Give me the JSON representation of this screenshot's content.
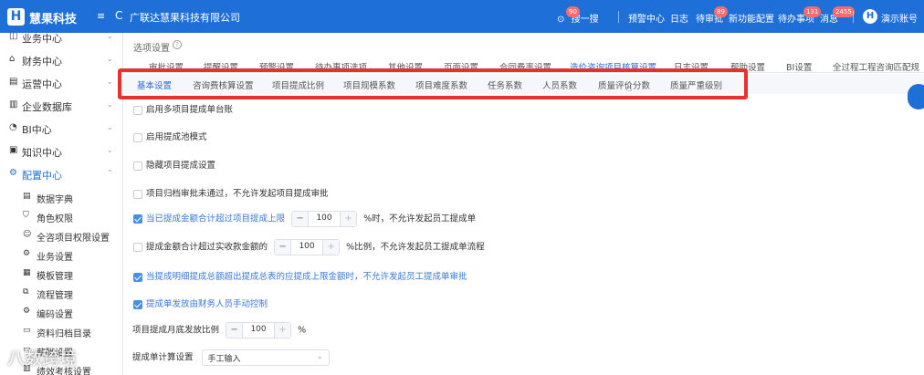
{
  "header": {
    "logo_letter": "H",
    "brand": "慧果科技",
    "menu_icon": "≡",
    "refresh_icon": "C",
    "company": "广联达慧果科技有限公司",
    "items": [
      {
        "label": "搜一搜",
        "badge": "90"
      },
      {
        "label": "预警中心",
        "badge": ""
      },
      {
        "label": "日志",
        "badge": ""
      },
      {
        "label": "待审批",
        "badge": "89"
      },
      {
        "label": "新功能配置",
        "badge": ""
      },
      {
        "label": "待办事项",
        "badge": "131"
      },
      {
        "label": "消息",
        "badge": "2455"
      },
      {
        "label": "演示账号",
        "badge": ""
      }
    ],
    "avatar_letter": "H"
  },
  "sidebar": {
    "items": [
      {
        "icon": "briefcase-icon",
        "label": "业务中心"
      },
      {
        "icon": "home-icon",
        "label": "财务中心"
      },
      {
        "icon": "building-icon",
        "label": "运营中心"
      },
      {
        "icon": "bar-chart-icon",
        "label": "企业数据库"
      },
      {
        "icon": "pie-icon",
        "label": "BI中心"
      },
      {
        "icon": "book-icon",
        "label": "知识中心"
      },
      {
        "icon": "gear-icon",
        "label": "配置中心"
      }
    ],
    "subitems": [
      {
        "label": "数据字典"
      },
      {
        "label": "角色权限"
      },
      {
        "label": "全咨项目权限设置"
      },
      {
        "label": "业务设置"
      },
      {
        "label": "模板管理"
      },
      {
        "label": "流程管理"
      },
      {
        "label": "编码设置"
      },
      {
        "label": "资料归档目录"
      },
      {
        "label": "薪酬设置"
      },
      {
        "label": "绩效考核设置"
      }
    ]
  },
  "main": {
    "breadcrumb": "选项设置",
    "help": "?",
    "tabs1": [
      {
        "label": "审批设置"
      },
      {
        "label": "提醒设置"
      },
      {
        "label": "预警设置"
      },
      {
        "label": "待办事项选项"
      },
      {
        "label": "其他设置"
      },
      {
        "label": "页面设置"
      },
      {
        "label": "合同费率设置"
      },
      {
        "label": "造价咨询项目核算设置"
      },
      {
        "label": "日志设置"
      },
      {
        "label": "帮助设置"
      },
      {
        "label": "BI设置"
      },
      {
        "label": "全过程工程咨询匹配规"
      }
    ],
    "tabs2": [
      {
        "label": "基本设置"
      },
      {
        "label": "咨询费核算设置"
      },
      {
        "label": "项目提成比例"
      },
      {
        "label": "项目规模系数"
      },
      {
        "label": "项目难度系数"
      },
      {
        "label": "任务系数"
      },
      {
        "label": "人员系数"
      },
      {
        "label": "质量评价分数"
      },
      {
        "label": "质量严重级别"
      }
    ],
    "options": {
      "opt1": "启用多项目提成单台账",
      "opt2": "启用提成池模式",
      "opt3": "隐藏项目提成设置",
      "opt4": "项目归档审批未通过，不允许发起项目提成审批",
      "opt5_pre": "当已提成金额合计超过项目提成上限",
      "opt5_val": "100",
      "opt5_post": "%时，不允许发起员工提成单",
      "opt6_pre": "提成金额合计超过实收款金额的",
      "opt6_val": "100",
      "opt6_post": "%比例，不允许发起员工提成单流程",
      "opt7": "当提成明细提成总额超出提成总表的应提成上限金额时，不允许发起员工提成单审批",
      "opt8": "提成单发放由财务人员手动控制",
      "row9_label": "项目提成月底发放比例",
      "row9_val": "100",
      "row9_unit": "%",
      "row10_label": "提成单计算设置",
      "row10_val": "手工输入"
    },
    "minus": "−",
    "plus": "+",
    "select_arrow": "⌄"
  },
  "watermark": "八数跨境",
  "colors": {
    "primary": "#1f6fd8",
    "highlight_box": "#e8302c",
    "badge": "#f56c6c"
  }
}
